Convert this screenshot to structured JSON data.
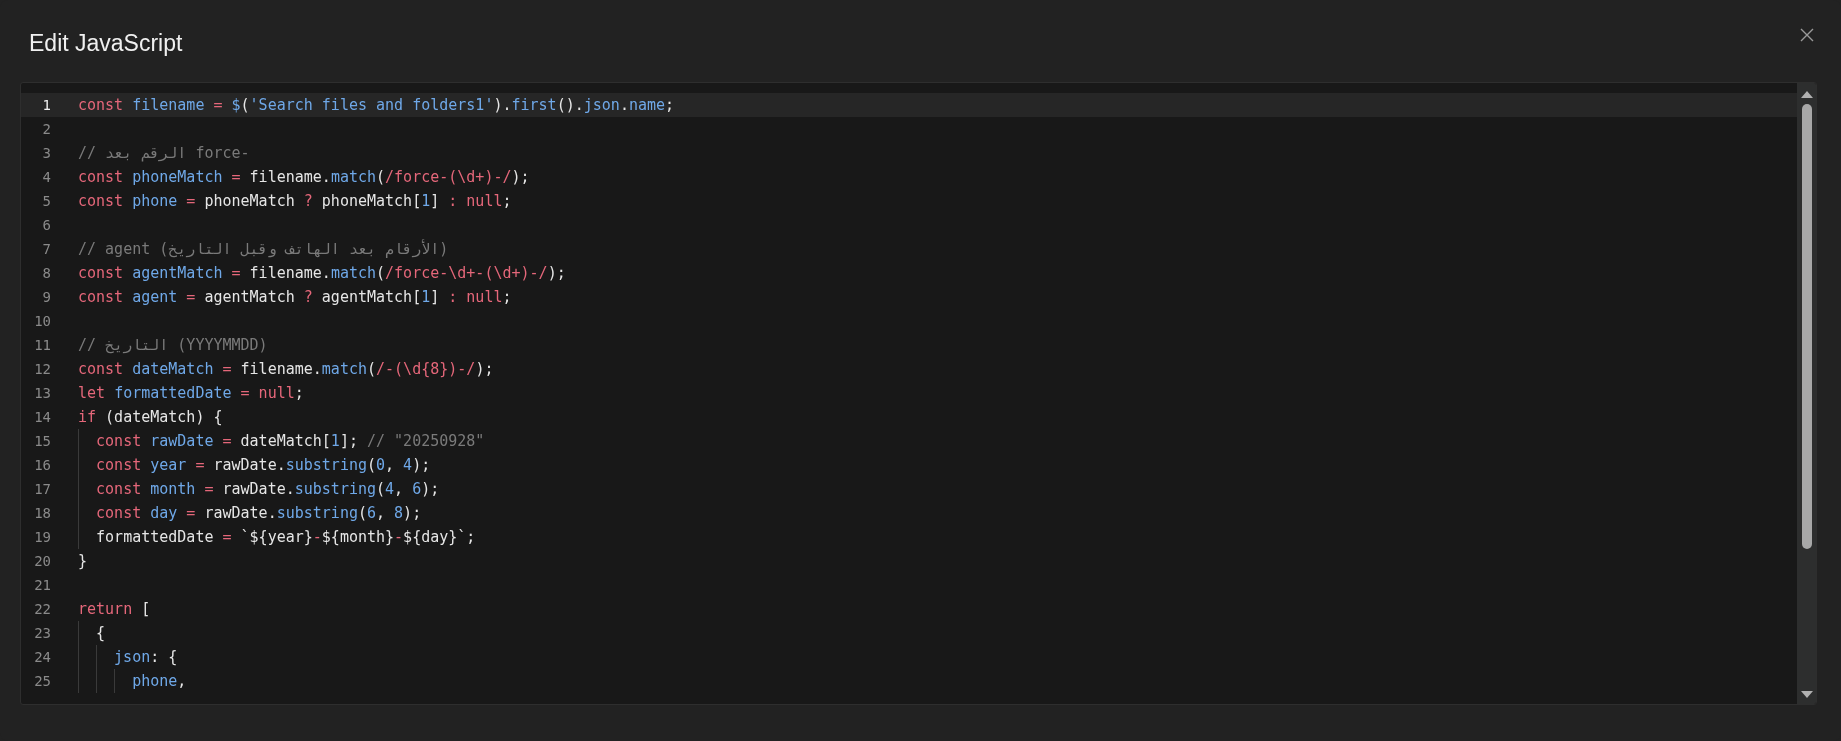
{
  "dialog": {
    "title": "Edit JavaScript"
  },
  "editor": {
    "lines": [
      {
        "number": "1",
        "selected": true,
        "tokens": [
          {
            "kind": "kw",
            "text": "const "
          },
          {
            "kind": "id",
            "text": "filename"
          },
          {
            "kind": "op",
            "text": " = "
          },
          {
            "kind": "id",
            "text": "$"
          },
          {
            "kind": "p",
            "text": "("
          },
          {
            "kind": "s",
            "text": "'Search files and folders1'"
          },
          {
            "kind": "p",
            "text": ")."
          },
          {
            "kind": "id",
            "text": "first"
          },
          {
            "kind": "p",
            "text": "()."
          },
          {
            "kind": "id",
            "text": "json"
          },
          {
            "kind": "p",
            "text": "."
          },
          {
            "kind": "id",
            "text": "name"
          },
          {
            "kind": "p",
            "text": ";"
          }
        ]
      },
      {
        "number": "2",
        "selected": false
      },
      {
        "number": "3",
        "selected": false,
        "tokens": [
          {
            "kind": "c",
            "text": "// الرقم بعد force-"
          }
        ]
      },
      {
        "number": "4",
        "selected": false,
        "tokens": [
          {
            "kind": "kw",
            "text": "const "
          },
          {
            "kind": "id",
            "text": "phoneMatch"
          },
          {
            "kind": "op",
            "text": " = "
          },
          {
            "kind": "p",
            "text": "filename."
          },
          {
            "kind": "id",
            "text": "match"
          },
          {
            "kind": "p",
            "text": "("
          },
          {
            "kind": "r",
            "text": "/force-(\\d+)-/"
          },
          {
            "kind": "p",
            "text": ");"
          }
        ]
      },
      {
        "number": "5",
        "selected": false,
        "tokens": [
          {
            "kind": "kw",
            "text": "const "
          },
          {
            "kind": "id",
            "text": "phone"
          },
          {
            "kind": "op",
            "text": " = "
          },
          {
            "kind": "p",
            "text": "phoneMatch "
          },
          {
            "kind": "op",
            "text": "? "
          },
          {
            "kind": "p",
            "text": "phoneMatch["
          },
          {
            "kind": "n",
            "text": "1"
          },
          {
            "kind": "p",
            "text": "] "
          },
          {
            "kind": "op",
            "text": ": null"
          },
          {
            "kind": "p",
            "text": ";"
          }
        ]
      },
      {
        "number": "6",
        "selected": false
      },
      {
        "number": "7",
        "selected": false,
        "tokens": [
          {
            "kind": "c",
            "text": "// agent (الأرقام بعد الهاتف وقبل التاريخ)"
          }
        ]
      },
      {
        "number": "8",
        "selected": false,
        "tokens": [
          {
            "kind": "kw",
            "text": "const "
          },
          {
            "kind": "id",
            "text": "agentMatch"
          },
          {
            "kind": "op",
            "text": " = "
          },
          {
            "kind": "p",
            "text": "filename."
          },
          {
            "kind": "id",
            "text": "match"
          },
          {
            "kind": "p",
            "text": "("
          },
          {
            "kind": "r",
            "text": "/force-\\d+-(\\d+)-/"
          },
          {
            "kind": "p",
            "text": ");"
          }
        ]
      },
      {
        "number": "9",
        "selected": false,
        "tokens": [
          {
            "kind": "kw",
            "text": "const "
          },
          {
            "kind": "id",
            "text": "agent"
          },
          {
            "kind": "op",
            "text": " = "
          },
          {
            "kind": "p",
            "text": "agentMatch "
          },
          {
            "kind": "op",
            "text": "? "
          },
          {
            "kind": "p",
            "text": "agentMatch["
          },
          {
            "kind": "n",
            "text": "1"
          },
          {
            "kind": "p",
            "text": "] "
          },
          {
            "kind": "op",
            "text": ": null"
          },
          {
            "kind": "p",
            "text": ";"
          }
        ]
      },
      {
        "number": "10",
        "selected": false
      },
      {
        "number": "11",
        "selected": false,
        "tokens": [
          {
            "kind": "c",
            "text": "// التاريخ (YYYYMMDD)"
          }
        ]
      },
      {
        "number": "12",
        "selected": false,
        "tokens": [
          {
            "kind": "kw",
            "text": "const "
          },
          {
            "kind": "id",
            "text": "dateMatch"
          },
          {
            "kind": "op",
            "text": " = "
          },
          {
            "kind": "p",
            "text": "filename."
          },
          {
            "kind": "id",
            "text": "match"
          },
          {
            "kind": "p",
            "text": "("
          },
          {
            "kind": "r",
            "text": "/-(\\d{8})-/"
          },
          {
            "kind": "p",
            "text": ");"
          }
        ]
      },
      {
        "number": "13",
        "selected": false,
        "tokens": [
          {
            "kind": "kw",
            "text": "let "
          },
          {
            "kind": "id",
            "text": "formattedDate"
          },
          {
            "kind": "op",
            "text": " = null"
          },
          {
            "kind": "p",
            "text": ";"
          }
        ]
      },
      {
        "number": "14",
        "selected": false,
        "tokens": [
          {
            "kind": "kw",
            "text": "if "
          },
          {
            "kind": "p",
            "text": "(dateMatch) {"
          }
        ],
        "children": [
          {
            "number": "15",
            "selected": false,
            "tokens": [
              {
                "kind": "kw",
                "text": "const "
              },
              {
                "kind": "id",
                "text": "rawDate"
              },
              {
                "kind": "op",
                "text": " = "
              },
              {
                "kind": "p",
                "text": "dateMatch["
              },
              {
                "kind": "n",
                "text": "1"
              },
              {
                "kind": "p",
                "text": "]; "
              },
              {
                "kind": "c",
                "text": "// \"20250928\""
              }
            ]
          },
          {
            "number": "16",
            "selected": false,
            "tokens": [
              {
                "kind": "kw",
                "text": "const "
              },
              {
                "kind": "id",
                "text": "year"
              },
              {
                "kind": "op",
                "text": " = "
              },
              {
                "kind": "p",
                "text": "rawDate."
              },
              {
                "kind": "id",
                "text": "substring"
              },
              {
                "kind": "p",
                "text": "("
              },
              {
                "kind": "n",
                "text": "0"
              },
              {
                "kind": "p",
                "text": ", "
              },
              {
                "kind": "n",
                "text": "4"
              },
              {
                "kind": "p",
                "text": ");"
              }
            ]
          },
          {
            "number": "17",
            "selected": false,
            "tokens": [
              {
                "kind": "kw",
                "text": "const "
              },
              {
                "kind": "id",
                "text": "month"
              },
              {
                "kind": "op",
                "text": " = "
              },
              {
                "kind": "p",
                "text": "rawDate."
              },
              {
                "kind": "id",
                "text": "substring"
              },
              {
                "kind": "p",
                "text": "("
              },
              {
                "kind": "n",
                "text": "4"
              },
              {
                "kind": "p",
                "text": ", "
              },
              {
                "kind": "n",
                "text": "6"
              },
              {
                "kind": "p",
                "text": ");"
              }
            ]
          },
          {
            "number": "18",
            "selected": false,
            "tokens": [
              {
                "kind": "kw",
                "text": "const "
              },
              {
                "kind": "id",
                "text": "day"
              },
              {
                "kind": "op",
                "text": " = "
              },
              {
                "kind": "p",
                "text": "rawDate."
              },
              {
                "kind": "id",
                "text": "substring"
              },
              {
                "kind": "p",
                "text": "("
              },
              {
                "kind": "n",
                "text": "6"
              },
              {
                "kind": "p",
                "text": ", "
              },
              {
                "kind": "n",
                "text": "8"
              },
              {
                "kind": "p",
                "text": ");"
              }
            ]
          },
          {
            "number": "19",
            "selected": false,
            "tokens": [
              {
                "kind": "p",
                "text": "formattedDate "
              },
              {
                "kind": "op",
                "text": "= "
              },
              {
                "kind": "p",
                "text": "`${year}"
              },
              {
                "kind": "op",
                "text": "-"
              },
              {
                "kind": "p",
                "text": "${month}"
              },
              {
                "kind": "op",
                "text": "-"
              },
              {
                "kind": "p",
                "text": "${day}`;"
              }
            ]
          }
        ]
      },
      {
        "number": "20",
        "selected": false,
        "tokens": [
          {
            "kind": "p",
            "text": "}"
          }
        ]
      },
      {
        "number": "21",
        "selected": false
      },
      {
        "number": "22",
        "selected": false,
        "tokens": [
          {
            "kind": "kw",
            "text": "return "
          },
          {
            "kind": "p",
            "text": "["
          }
        ],
        "children": [
          {
            "number": "23",
            "selected": false,
            "tokens": [
              {
                "kind": "p",
                "text": "{"
              }
            ],
            "children": [
              {
                "number": "24",
                "selected": false,
                "tokens": [
                  {
                    "kind": "id",
                    "text": "json"
                  },
                  {
                    "kind": "p",
                    "text": ": {"
                  }
                ],
                "children": [
                  {
                    "number": "25",
                    "selected": false,
                    "tokens": [
                      {
                        "kind": "id",
                        "text": "phone"
                      },
                      {
                        "kind": "p",
                        "text": ","
                      }
                    ]
                  }
                ]
              }
            ]
          }
        ]
      }
    ]
  }
}
